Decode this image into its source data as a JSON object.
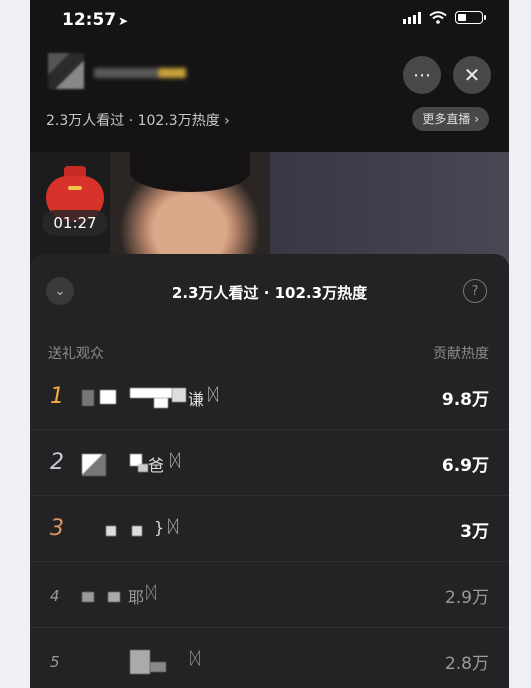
{
  "status_bar": {
    "time": "12:57",
    "battery_level": 0.35
  },
  "stream": {
    "stats": "2.3万人看过 · 102.3万热度 ›",
    "more_live": "更多直播 ›",
    "more_icon": "⋯",
    "close_icon": "✕"
  },
  "red_packet": {
    "countdown": "01:27"
  },
  "panel": {
    "title": "2.3万人看过 · 102.3万热度",
    "collapse_icon": "⌄",
    "help_icon": "?",
    "col_left": "送礼观众",
    "col_right": "贡献热度",
    "ranks": [
      {
        "rank": "1",
        "name_tail": "谦",
        "badge": "ᛞ",
        "heat": "9.8万",
        "rank_color": "#f0b040"
      },
      {
        "rank": "2",
        "name_tail": "爸",
        "badge": "ᛞ",
        "heat": "6.9万",
        "rank_color": "#c8ccd2"
      },
      {
        "rank": "3",
        "name_tail": "}",
        "badge": "ᛞ",
        "heat": "3万",
        "rank_color": "#e0935e"
      },
      {
        "rank": "4",
        "name_tail": "耶",
        "badge": "ᛞ",
        "heat": "2.9万",
        "rank_color": "#9a9a9a"
      },
      {
        "rank": "5",
        "name_tail": "",
        "badge": "ᛞ",
        "heat": "2.8万",
        "rank_color": "#9a9a9a"
      }
    ]
  }
}
